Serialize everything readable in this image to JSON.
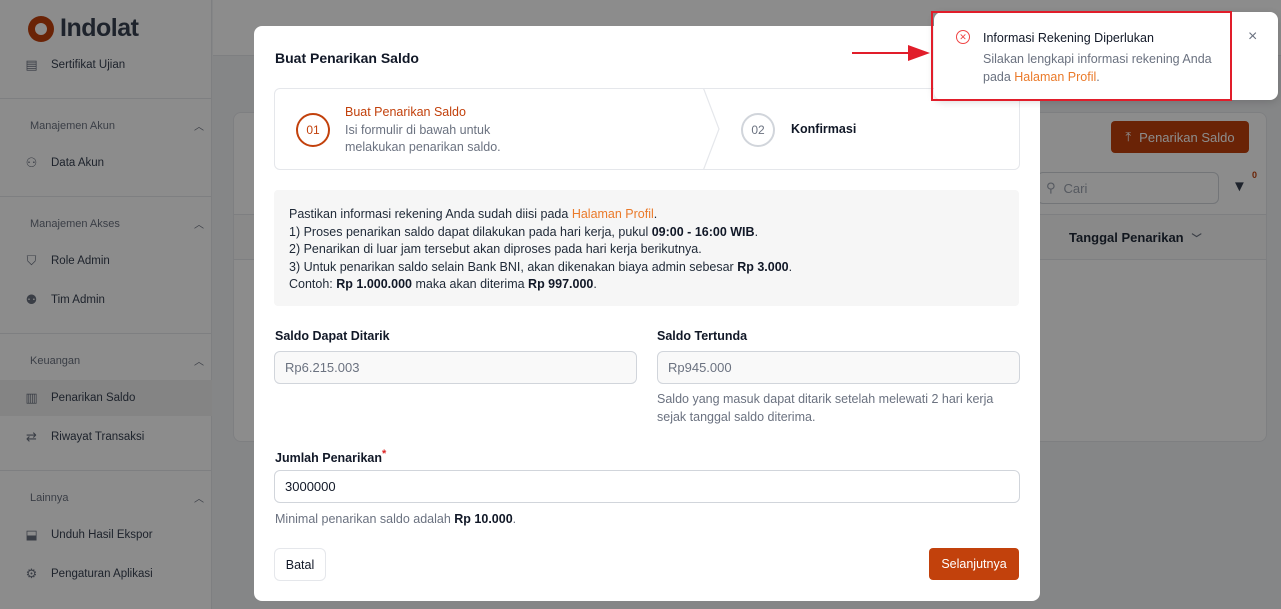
{
  "app": {
    "logo_text": "Indolat"
  },
  "sidebar": {
    "top_item": {
      "label": "Sertifikat Ujian",
      "icon": "certificate-icon"
    },
    "sections": [
      {
        "label": "Manajemen Akun",
        "items": [
          {
            "label": "Data Akun",
            "icon": "users-icon"
          }
        ]
      },
      {
        "label": "Manajemen Akses",
        "items": [
          {
            "label": "Role Admin",
            "icon": "shield-icon"
          },
          {
            "label": "Tim Admin",
            "icon": "team-icon"
          }
        ]
      },
      {
        "label": "Keuangan",
        "items": [
          {
            "label": "Penarikan Saldo",
            "icon": "document-icon",
            "active": true
          },
          {
            "label": "Riwayat Transaksi",
            "icon": "transfer-icon"
          }
        ]
      },
      {
        "label": "Lainnya",
        "items": [
          {
            "label": "Unduh Hasil Ekspor",
            "icon": "download-icon"
          },
          {
            "label": "Pengaturan Aplikasi",
            "icon": "settings-icon"
          }
        ]
      }
    ]
  },
  "background": {
    "primary_button": "Penarikan Saldo",
    "search_placeholder": "Cari",
    "filter_count": "0",
    "column_header": "Tanggal Penarikan"
  },
  "modal": {
    "title": "Buat Penarikan Saldo",
    "steps": [
      {
        "number": "01",
        "title": "Buat Penarikan Saldo",
        "description": "Isi formulir di bawah untuk melakukan penarikan saldo."
      },
      {
        "number": "02",
        "title": "Konfirmasi"
      }
    ],
    "info": {
      "line0_pre": "Pastikan informasi rekening Anda sudah diisi pada ",
      "line0_link": "Halaman Profil",
      "line0_post": ".",
      "line1_pre": "1) Proses penarikan saldo dapat dilakukan pada hari kerja, pukul ",
      "line1_bold": "09:00 - 16:00 WIB",
      "line1_post": ".",
      "line2": "2) Penarikan di luar jam tersebut akan diproses pada hari kerja berikutnya.",
      "line3_pre": "3) Untuk penarikan saldo selain Bank BNI, akan dikenakan biaya admin sebesar ",
      "line3_bold": "Rp 3.000",
      "line3_post": ".",
      "line4_pre": "Contoh: ",
      "line4_bold1": "Rp 1.000.000",
      "line4_mid": " maka akan diterima ",
      "line4_bold2": "Rp 997.000",
      "line4_post": "."
    },
    "saldo_ditarik": {
      "label": "Saldo Dapat Ditarik",
      "value": "Rp6.215.003"
    },
    "saldo_tertunda": {
      "label": "Saldo Tertunda",
      "value": "Rp945.000",
      "help": "Saldo yang masuk dapat ditarik setelah melewati 2 hari kerja sejak tanggal saldo diterima."
    },
    "jumlah": {
      "label": "Jumlah Penarikan",
      "required_mark": "*",
      "value": "3000000",
      "help_pre": "Minimal penarikan saldo adalah ",
      "help_bold": "Rp 10.000",
      "help_post": "."
    },
    "cancel_label": "Batal",
    "next_label": "Selanjutnya"
  },
  "toast": {
    "title": "Informasi Rekening Diperlukan",
    "message_pre": "Silakan lengkapi informasi rekening Anda pada ",
    "message_link": "Halaman Profil",
    "message_post": ".",
    "close": "×"
  }
}
